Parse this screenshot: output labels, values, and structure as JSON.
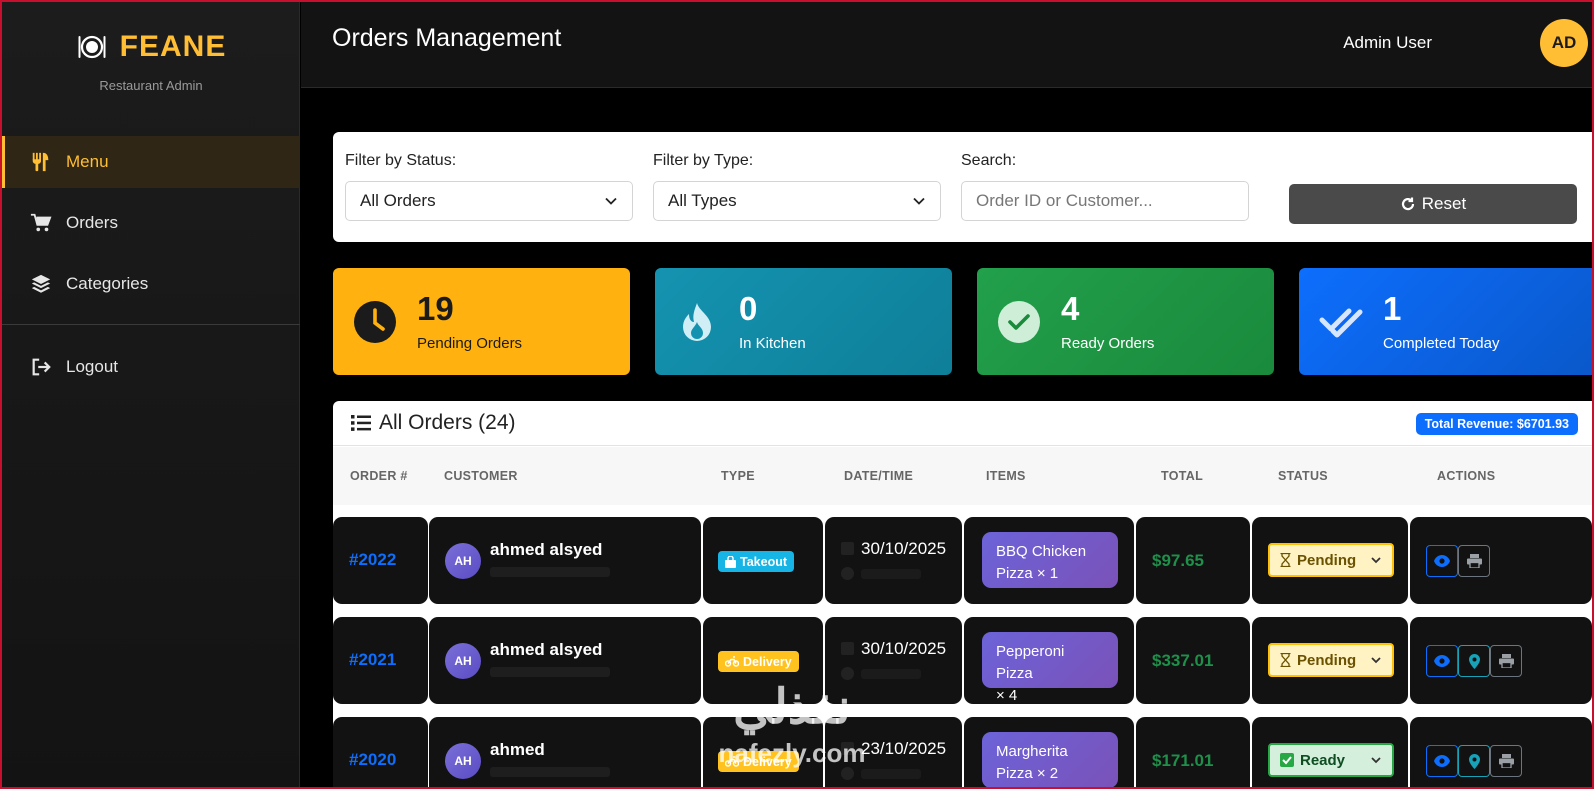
{
  "brand": {
    "name": "FEANE",
    "subtitle": "Restaurant Admin",
    "accent": "#ffbe33"
  },
  "sidebar": {
    "items": [
      {
        "label": "Menu",
        "icon": "utensils-icon",
        "active": true
      },
      {
        "label": "Orders",
        "icon": "cart-icon",
        "active": false
      },
      {
        "label": "Categories",
        "icon": "layers-icon",
        "active": false
      }
    ],
    "logout_label": "Logout"
  },
  "header": {
    "title": "Orders Management",
    "user_name": "Admin User",
    "user_initials": "AD"
  },
  "filters": {
    "status_label": "Filter by Status:",
    "status_value": "All Orders",
    "type_label": "Filter by Type:",
    "type_value": "All Types",
    "search_label": "Search:",
    "search_placeholder": "Order ID or Customer...",
    "reset_label": "Reset"
  },
  "stats": [
    {
      "value": "19",
      "label": "Pending Orders",
      "icon": "clock-icon"
    },
    {
      "value": "0",
      "label": "In Kitchen",
      "icon": "fire-icon"
    },
    {
      "value": "4",
      "label": "Ready Orders",
      "icon": "check-circle-icon"
    },
    {
      "value": "1",
      "label": "Completed Today",
      "icon": "double-check-icon"
    }
  ],
  "orders_panel": {
    "title": "All Orders (24)",
    "revenue": "Total Revenue: $6701.93",
    "columns": [
      "ORDER #",
      "CUSTOMER",
      "TYPE",
      "DATE/TIME",
      "ITEMS",
      "TOTAL",
      "STATUS",
      "ACTIONS"
    ]
  },
  "orders": [
    {
      "id": "#2022",
      "initials": "AH",
      "customer": "ahmed alsyed",
      "type": "Takeout",
      "date": "30/10/2025",
      "item_line1": "BBQ Chicken",
      "item_line2": "Pizza × 1",
      "total": "$97.65",
      "status": "Pending"
    },
    {
      "id": "#2021",
      "initials": "AH",
      "customer": "ahmed alsyed",
      "type": "Delivery",
      "date": "30/10/2025",
      "item_line1": "Pepperoni Pizza",
      "item_line2": "× 4",
      "total": "$337.01",
      "status": "Pending"
    },
    {
      "id": "#2020",
      "initials": "AH",
      "customer": "ahmed",
      "type": "Delivery",
      "date": "23/10/2025",
      "item_line1": "Margherita",
      "item_line2": "Pizza × 2",
      "total": "$171.01",
      "status": "Ready"
    }
  ],
  "watermark": {
    "arabic": "نفذلي",
    "latin": "nafezly.com"
  }
}
